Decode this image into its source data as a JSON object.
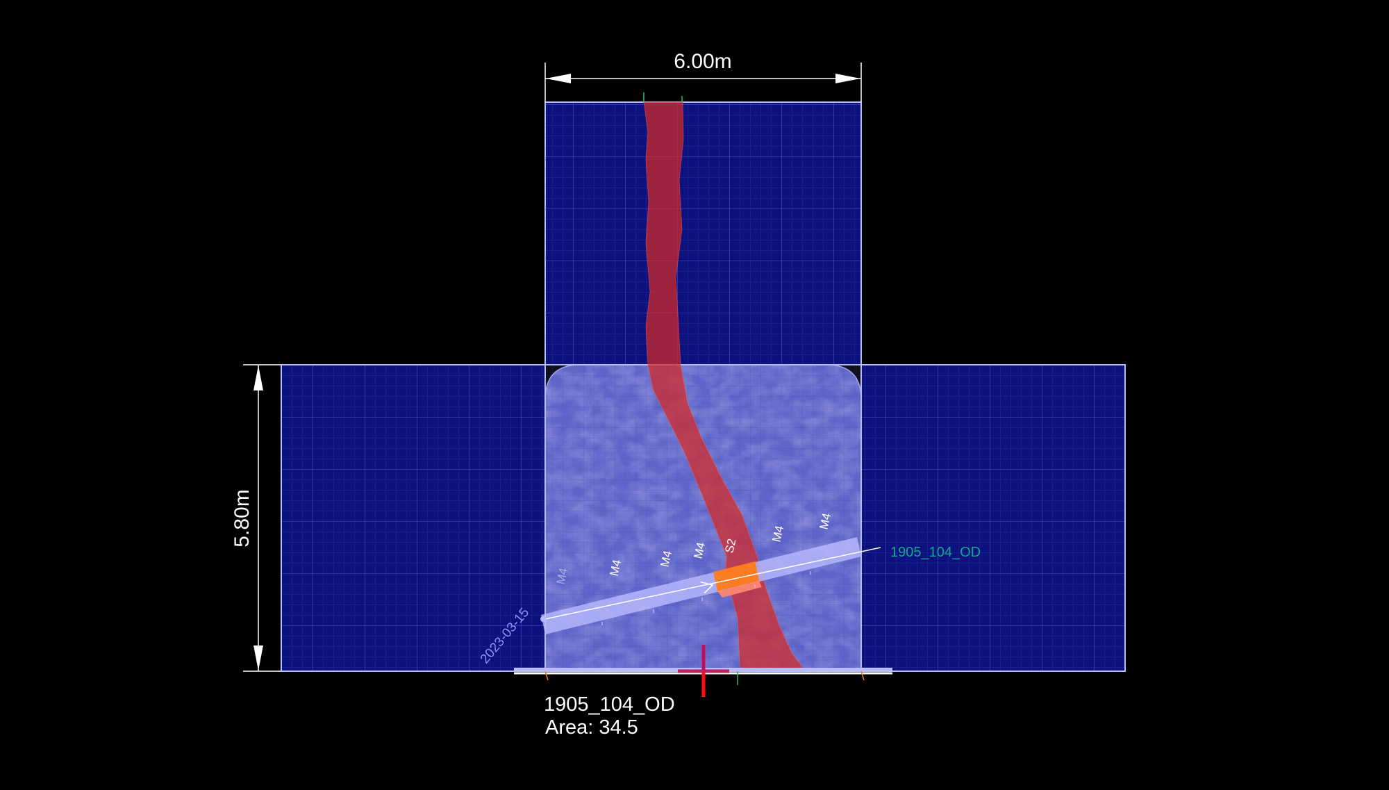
{
  "dimensions": {
    "width_label": "6.00m",
    "height_label": "5.80m"
  },
  "face": {
    "name": "1905_104_OD",
    "area": "Area: 34.5"
  },
  "scanline": {
    "label": "1905_104_OD",
    "date": "2023-03-15",
    "segments": [
      "M4",
      "M4",
      "M4",
      "M4",
      "S2",
      "M4",
      "M4"
    ]
  },
  "colors": {
    "background": "#000000",
    "panel_fill": "#0c117e",
    "grid_line": "#3a45c4",
    "panel_border": "#b9bdf6",
    "rock_face": "#5d63c8",
    "vein": "#d22a25",
    "scanline": "#b9bcff",
    "intersection": "#ff7a1a",
    "scan_label": "#10a890"
  }
}
